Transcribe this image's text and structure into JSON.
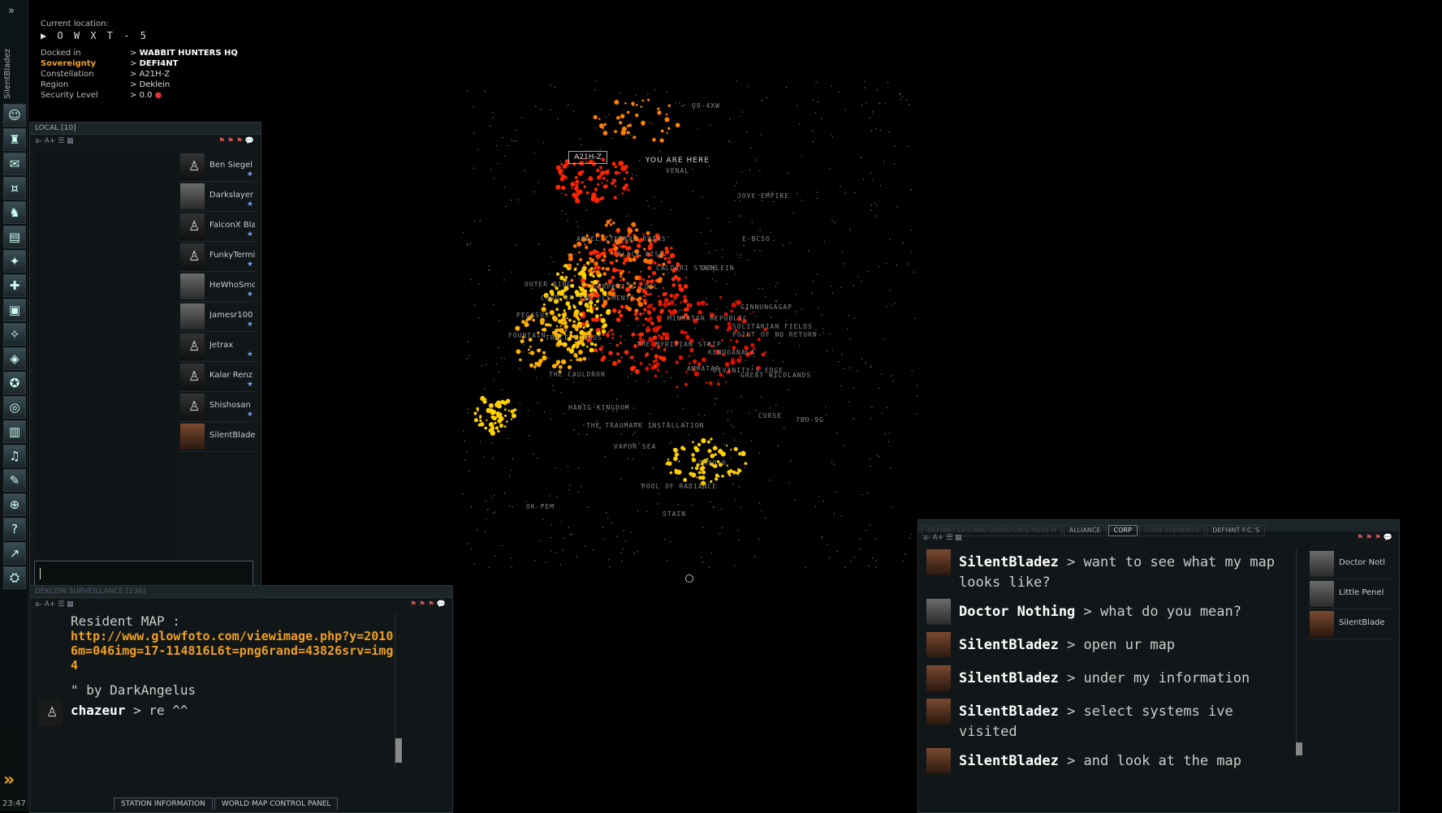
{
  "neocom": {
    "pilot_name": "SilentBladez",
    "clock": "23:47",
    "buttons": [
      "character-sheet-icon",
      "people-places-icon",
      "mail-icon",
      "wallet-icon",
      "corporation-icon",
      "journal-icon",
      "map-icon",
      "fitting-icon",
      "assets-icon",
      "science-icon",
      "market-icon",
      "navy-icon",
      "skills-icon",
      "evemail-icon",
      "audio-icon",
      "notepad-icon",
      "browser-icon",
      "help-icon",
      "undock-icon",
      "ships-icon"
    ]
  },
  "location": {
    "current_label": "Current location:",
    "system": "O W X T - 5",
    "rows": [
      {
        "key": "Docked in",
        "value": "WABBIT HUNTERS HQ"
      },
      {
        "key": "Sovereignty",
        "value": "DEFI4NT"
      },
      {
        "key": "Constellation",
        "value": "A21H-Z"
      },
      {
        "key": "Region",
        "value": "Deklein"
      },
      {
        "key": "Security Level",
        "value": "0.0"
      }
    ]
  },
  "local": {
    "title": "LOCAL [10]",
    "font_controls": "a-  A+",
    "members": [
      {
        "name": "Ben Siegel",
        "port": "sil"
      },
      {
        "name": "Darkslayer",
        "port": "face"
      },
      {
        "name": "FalconX Bla",
        "port": "sil"
      },
      {
        "name": "FunkyTermi",
        "port": "sil"
      },
      {
        "name": "HeWhoSmo",
        "port": "face"
      },
      {
        "name": "Jamesr100",
        "port": "face"
      },
      {
        "name": "Jetrax",
        "port": "sil"
      },
      {
        "name": "Kalar Renz",
        "port": "sil"
      },
      {
        "name": "Shishosan",
        "port": "sil"
      },
      {
        "name": "SilentBladez",
        "port": "face2"
      }
    ]
  },
  "survchat": {
    "title": "DEKLEIN SURVEILLANCE [236]",
    "line1": "Resident MAP :",
    "link": "http://www.glowfoto.com/viewimage.php?y=20106m=046img=17-114816L6t=png6rand=43826srv=img4",
    "line2": "\" by DarkAngelus",
    "msg_author": "chazeur",
    "msg_text": " > re ^^"
  },
  "bottom_tabs": [
    "STATION INFORMATION",
    "WORLD MAP CONTROL PANEL"
  ],
  "map": {
    "marker_label": "A21H-Z",
    "you_are_here": "YOU ARE HERE",
    "labels": [
      {
        "text": "O9-4XW"
      },
      {
        "text": "VENAL"
      },
      {
        "text": "JOVE EMPIRE"
      },
      {
        "text": "E-BCSO"
      },
      {
        "text": "ANGEL ETERNAL RUINS"
      },
      {
        "text": "BLACK RISE"
      },
      {
        "text": "CALDARI STATE"
      },
      {
        "text": "DEKLEIN"
      },
      {
        "text": "OUTER RING"
      },
      {
        "text": "SERPENT'S COIL"
      },
      {
        "text": "CORD OF THE ELEMENTS"
      },
      {
        "text": "GINNUNGAGAP"
      },
      {
        "text": "PEGASUS"
      },
      {
        "text": "MINMATAR REPUBLIC"
      },
      {
        "text": "SOLITARIAN FIELDS"
      },
      {
        "text": "POINT OF NO RETURN"
      },
      {
        "text": "FOUNTAIN"
      },
      {
        "text": "TRACE COSMOS"
      },
      {
        "text": "THE MYRIDIAN STRIP"
      },
      {
        "text": "KENDOANALA"
      },
      {
        "text": "AMMATAR"
      },
      {
        "text": "DIVINITY'S EDGE"
      },
      {
        "text": "THE CAULDRON"
      },
      {
        "text": "GREAT WILDLANDS"
      },
      {
        "text": "HANIG KINGDOM"
      },
      {
        "text": "CURSE"
      },
      {
        "text": "THE TRAUMARK INSTALLATION"
      },
      {
        "text": "7BO-9G"
      },
      {
        "text": "VAPOR SEA"
      },
      {
        "text": "SHXO-6"
      },
      {
        "text": "POOL OF RADIANCE"
      },
      {
        "text": "OK-FEM"
      },
      {
        "text": "STAIN"
      }
    ]
  },
  "corpchat": {
    "tabs": [
      "DEFIANT CEO AND DIRECTOR'S MESS H",
      "ALLIANCE",
      "CORP",
      "CORE ELEMENTS",
      "DEFI4NT F.C.'S"
    ],
    "messages": [
      {
        "author": "SilentBladez",
        "text": " > want to see what my map looks like?",
        "port": "sil"
      },
      {
        "author": "Doctor Nothing",
        "text": " > what do you mean?",
        "port": "doc"
      },
      {
        "author": "SilentBladez",
        "text": " > open ur map",
        "port": "sil"
      },
      {
        "author": "SilentBladez",
        "text": " > under my information",
        "port": "sil"
      },
      {
        "author": "SilentBladez",
        "text": " > select systems ive visited",
        "port": "sil"
      },
      {
        "author": "SilentBladez",
        "text": " > and look at the map",
        "port": "sil"
      }
    ],
    "members": [
      {
        "name": "Doctor Nothi",
        "port": "face"
      },
      {
        "name": "Little Penelop",
        "port": "face"
      },
      {
        "name": "SilentBladez",
        "port": "face2"
      }
    ]
  }
}
